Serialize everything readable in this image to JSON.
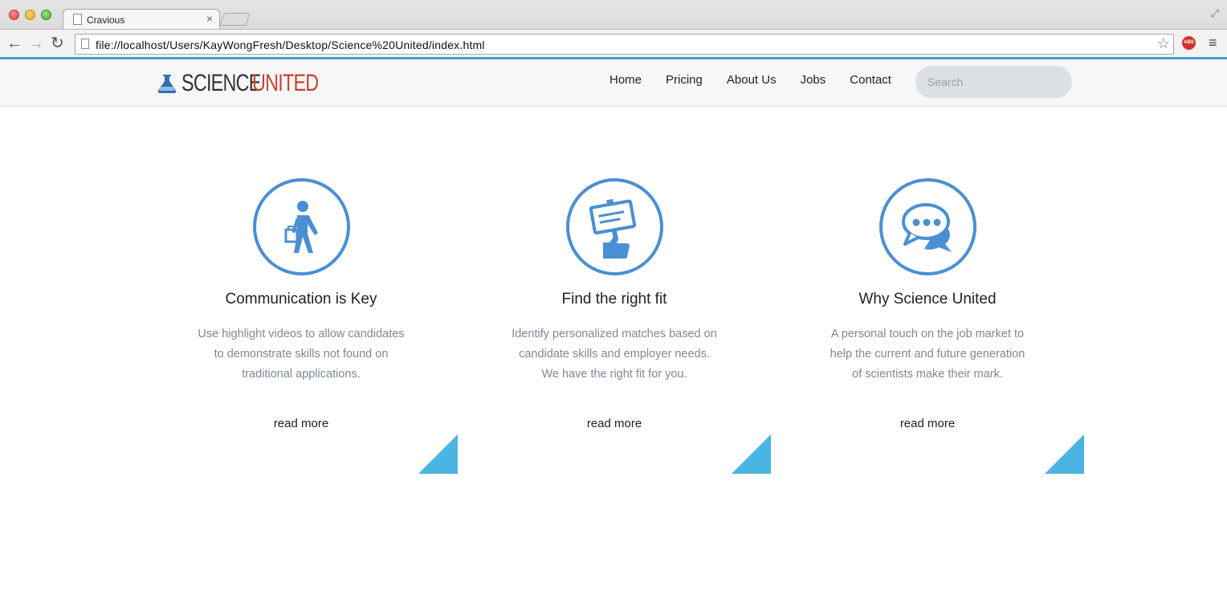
{
  "browser": {
    "tab_title": "Cravious",
    "tab_close": "×",
    "url": "file://localhost/Users/KayWongFresh/Desktop/Science%20United/index.html",
    "abp_label": "ABS",
    "back": "←",
    "forward": "→",
    "reload": "↻",
    "star": "☆",
    "menu": "≡",
    "fullscreen": "⤢"
  },
  "site": {
    "logo_science": "SCIENCE",
    "logo_united": "UNITED",
    "nav": [
      "Home",
      "Pricing",
      "About Us",
      "Jobs",
      "Contact"
    ],
    "search_placeholder": "Search"
  },
  "features": [
    {
      "icon": "walking-person-icon",
      "title": "Communication is Key",
      "text_lines": [
        "Use highlight videos to allow candidates",
        "to demonstrate skills not found on",
        "traditional applications."
      ],
      "link": "read more"
    },
    {
      "icon": "sign-thumbs-up-icon",
      "title": "Find the right fit",
      "text_lines": [
        "Identify personalized matches based on",
        "candidate skills and employer needs.",
        "We have the right fit for you."
      ],
      "link": "read more"
    },
    {
      "icon": "chat-bubbles-icon",
      "title": "Why Science United",
      "text_lines": [
        "A personal touch on the job market to",
        "help the current and future generation",
        "of scientists make their mark."
      ],
      "link": "read more"
    }
  ],
  "colors": {
    "accent_blue": "#4a8fd4",
    "corner_blue": "#4ab4e2",
    "logo_red": "#c8442f",
    "text_grey": "#7f8994"
  }
}
